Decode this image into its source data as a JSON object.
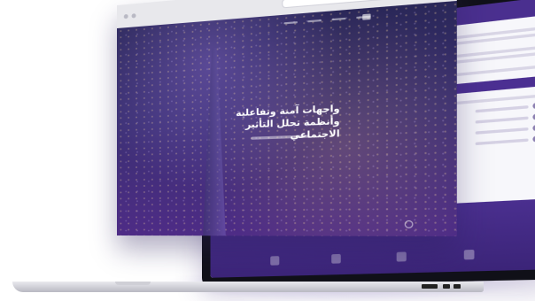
{
  "hero": {
    "line1": "واجهات آمنة وتفاعلية",
    "line2": "وأنظمة تحلل التأثير الاجتماعي"
  },
  "colors": {
    "brand_purple": "#4a2f8f",
    "browser_chrome": "#e8e8ec",
    "dot_red": "#ff6b5a",
    "dot_yellow": "#f5c04a",
    "dot_green": "#53c46a"
  }
}
